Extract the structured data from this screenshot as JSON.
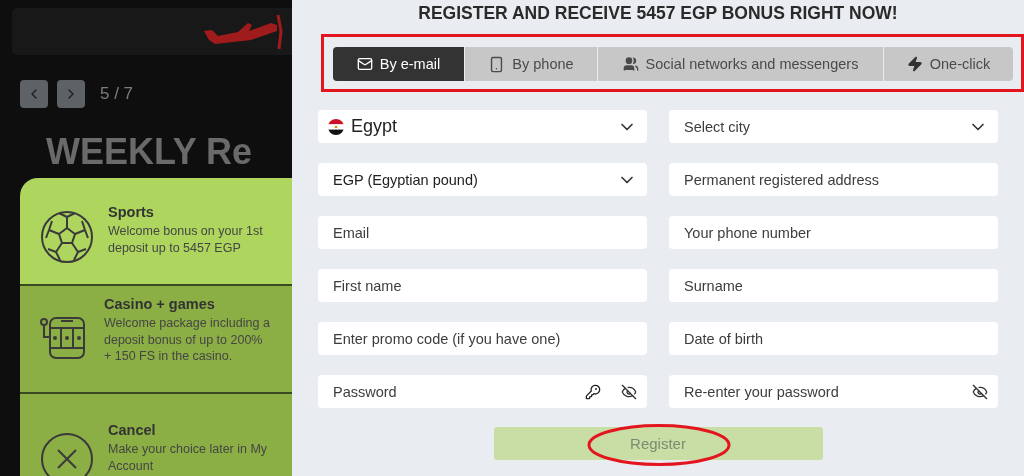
{
  "promo": {
    "counter": "5 / 7",
    "heading": "WEEKLY Re"
  },
  "bonus_options": [
    {
      "kind": "sports",
      "title": "Sports",
      "description": "Welcome bonus on your 1st deposit up to 5457 EGP",
      "selected": true
    },
    {
      "kind": "casino",
      "title": "Casino + games",
      "description": "Welcome package including a deposit bonus of up to 200% + 150 FS in the casino.",
      "selected": false
    },
    {
      "kind": "cancel",
      "title": "Cancel",
      "description": "Make your choice later in My Account",
      "selected": false
    }
  ],
  "title": "REGISTER AND RECEIVE 5457 EGP BONUS RIGHT NOW!",
  "tabs": [
    {
      "kind": "email",
      "label": "By e-mail",
      "selected": true
    },
    {
      "kind": "phone",
      "label": "By phone",
      "selected": false
    },
    {
      "kind": "social",
      "label": "Social networks and messengers",
      "selected": false
    },
    {
      "kind": "oneclick",
      "label": "One-click",
      "selected": false
    }
  ],
  "fields": [
    {
      "kind": "country",
      "value": "Egypt"
    },
    {
      "kind": "select",
      "placeholder": "Select city"
    },
    {
      "kind": "select",
      "value": "EGP (Egyptian pound)"
    },
    {
      "kind": "input",
      "placeholder": "Permanent registered address"
    },
    {
      "kind": "input",
      "placeholder": "Email"
    },
    {
      "kind": "input",
      "placeholder": "Your phone number"
    },
    {
      "kind": "input",
      "placeholder": "First name"
    },
    {
      "kind": "input",
      "placeholder": "Surname"
    },
    {
      "kind": "input",
      "placeholder": "Enter promo code (if you have one)"
    },
    {
      "kind": "input",
      "placeholder": "Date of birth"
    },
    {
      "kind": "password",
      "placeholder": "Password",
      "key_icon": true
    },
    {
      "kind": "password",
      "placeholder": "Re-enter your password",
      "key_icon": false
    }
  ],
  "register_button": {
    "label": "Register",
    "disabled": true
  }
}
